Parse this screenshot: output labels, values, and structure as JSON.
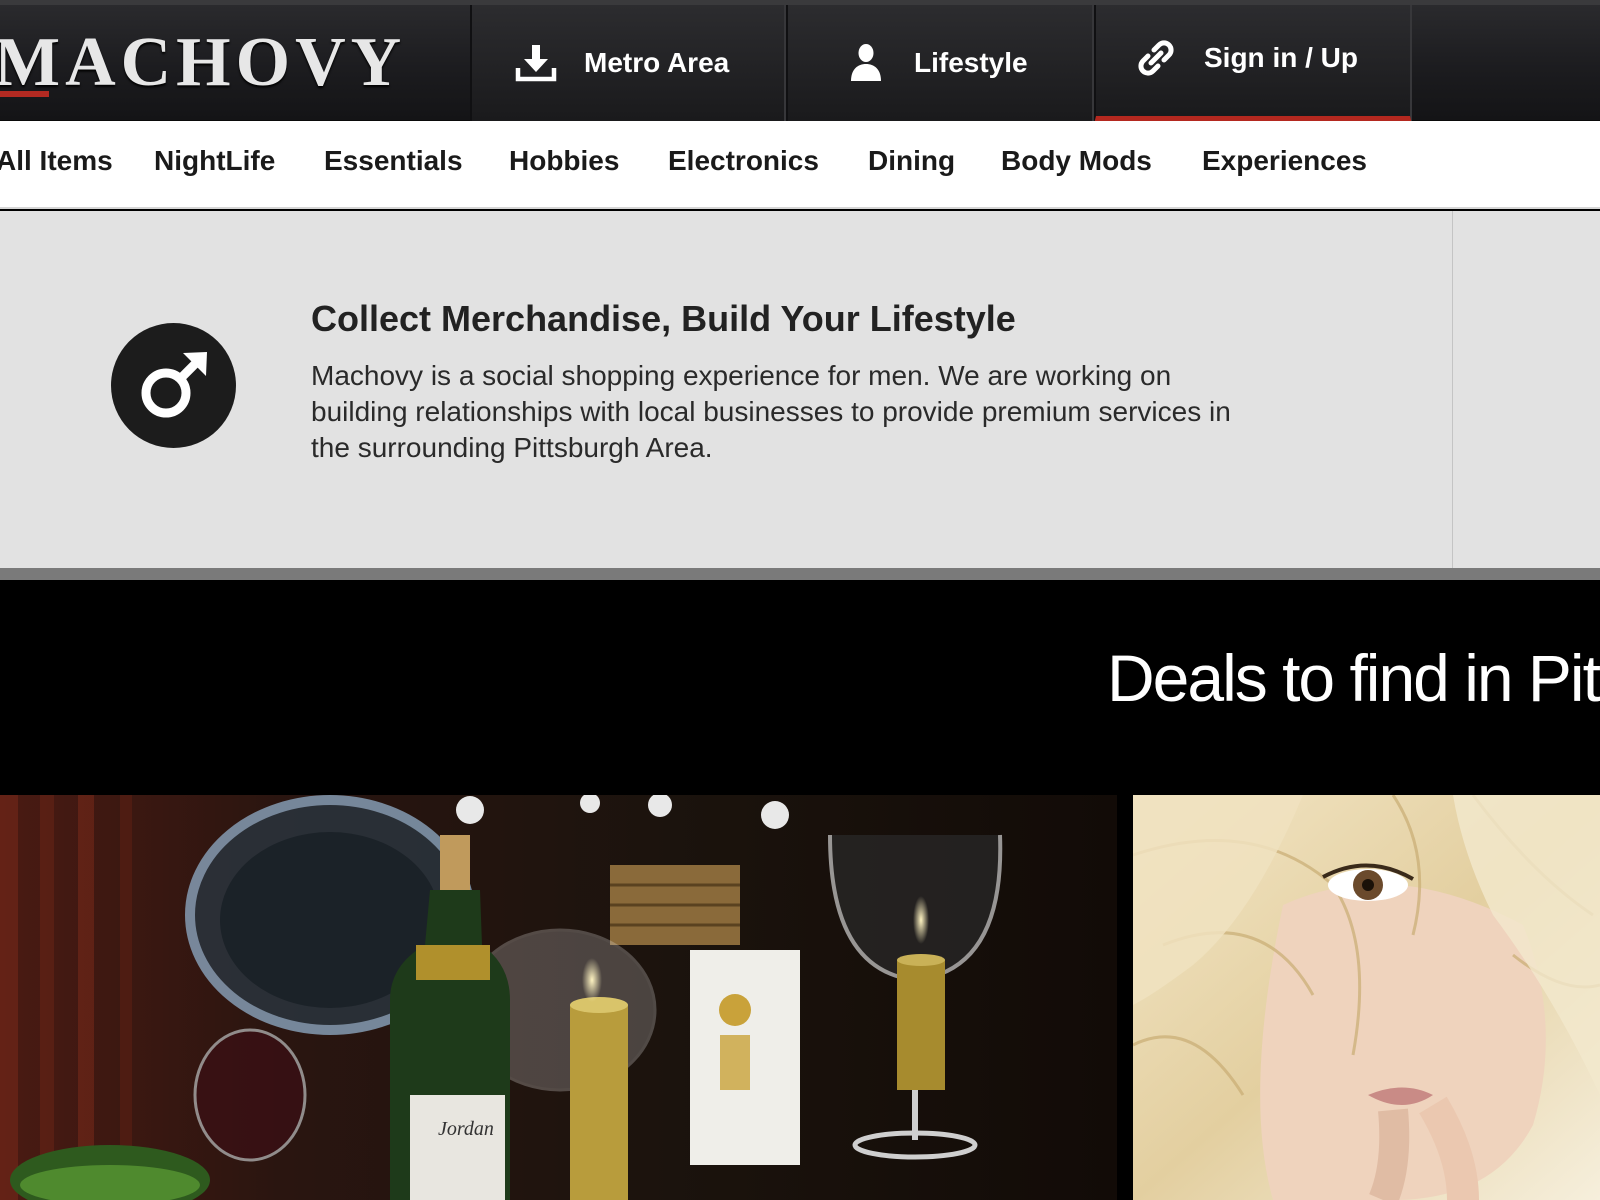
{
  "header": {
    "logo": "MACHOVY",
    "tabs": [
      {
        "label": "Metro Area",
        "icon": "download-icon"
      },
      {
        "label": "Lifestyle",
        "icon": "user-icon"
      },
      {
        "label": "Sign in / Up",
        "icon": "link-icon",
        "active": true
      }
    ],
    "accent_color": "#b4281f"
  },
  "categories": [
    "All Items",
    "NightLife",
    "Essentials",
    "Hobbies",
    "Electronics",
    "Dining",
    "Body Mods",
    "Experiences"
  ],
  "intro": {
    "icon": "male-symbol-icon",
    "title": "Collect Merchandise, Build Your Lifestyle",
    "text": "Machovy is a social shopping experience for men. We are working on building relationships with local businesses to provide premium services in the surrounding Pittsburgh Area."
  },
  "deals": {
    "title": "Deals to find in Pitts"
  }
}
